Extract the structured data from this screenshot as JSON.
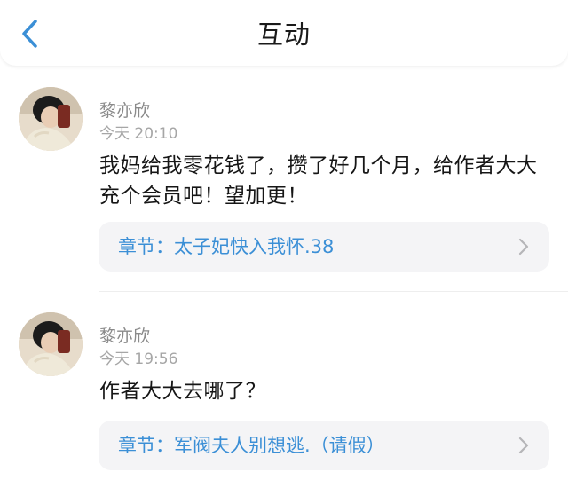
{
  "header": {
    "title": "互动",
    "back_icon": "chevron-left-icon",
    "accent_color": "#3b8fd6"
  },
  "comments": [
    {
      "username": "黎亦欣",
      "time": "今天 20:10",
      "text": "我妈给我零花钱了，攒了好几个月，给作者大大充个会员吧！望加更！",
      "chapter": "章节：太子妃快入我怀.38"
    },
    {
      "username": "黎亦欣",
      "time": "今天 19:56",
      "text": "作者大大去哪了？",
      "chapter": "章节：军阀夫人别想逃.（请假）"
    }
  ]
}
